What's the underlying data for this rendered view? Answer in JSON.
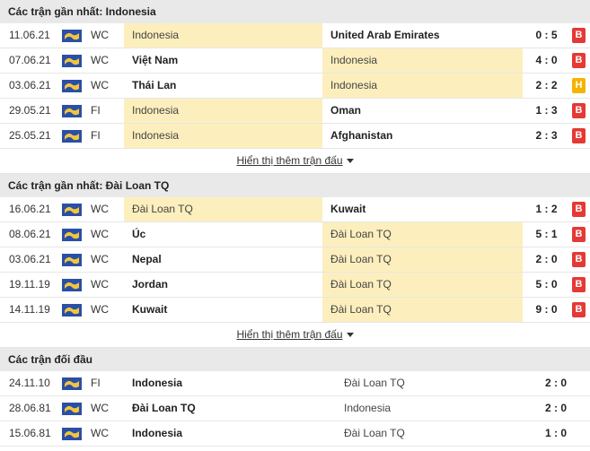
{
  "colors": {
    "header_bg": "#e9e9e9",
    "highlight": "#fcefbd",
    "loss": "#e53935",
    "draw": "#f4b400"
  },
  "sections": [
    {
      "title": "Các trận gần nhất: Indonesia",
      "more_label": "Hiển thị thêm trận đấu",
      "matches": [
        {
          "date": "11.06.21",
          "comp": "WC",
          "home": "Indonesia",
          "away": "United Arab Emirates",
          "score": "0 : 5",
          "result": "B",
          "hl": "home"
        },
        {
          "date": "07.06.21",
          "comp": "WC",
          "home": "Việt Nam",
          "away": "Indonesia",
          "score": "4 : 0",
          "result": "B",
          "hl": "away"
        },
        {
          "date": "03.06.21",
          "comp": "WC",
          "home": "Thái Lan",
          "away": "Indonesia",
          "score": "2 : 2",
          "result": "H",
          "hl": "away"
        },
        {
          "date": "29.05.21",
          "comp": "FI",
          "home": "Indonesia",
          "away": "Oman",
          "score": "1 : 3",
          "result": "B",
          "hl": "home"
        },
        {
          "date": "25.05.21",
          "comp": "FI",
          "home": "Indonesia",
          "away": "Afghanistan",
          "score": "2 : 3",
          "result": "B",
          "hl": "home"
        }
      ]
    },
    {
      "title": "Các trận gần nhất: Đài Loan TQ",
      "more_label": "Hiển thị thêm trận đấu",
      "matches": [
        {
          "date": "16.06.21",
          "comp": "WC",
          "home": "Đài Loan TQ",
          "away": "Kuwait",
          "score": "1 : 2",
          "result": "B",
          "hl": "home"
        },
        {
          "date": "08.06.21",
          "comp": "WC",
          "home": "Úc",
          "away": "Đài Loan TQ",
          "score": "5 : 1",
          "result": "B",
          "hl": "away"
        },
        {
          "date": "03.06.21",
          "comp": "WC",
          "home": "Nepal",
          "away": "Đài Loan TQ",
          "score": "2 : 0",
          "result": "B",
          "hl": "away"
        },
        {
          "date": "19.11.19",
          "comp": "WC",
          "home": "Jordan",
          "away": "Đài Loan TQ",
          "score": "5 : 0",
          "result": "B",
          "hl": "away"
        },
        {
          "date": "14.11.19",
          "comp": "WC",
          "home": "Kuwait",
          "away": "Đài Loan TQ",
          "score": "9 : 0",
          "result": "B",
          "hl": "away"
        }
      ]
    }
  ],
  "h2h": {
    "title": "Các trận đối đầu",
    "matches": [
      {
        "date": "24.11.10",
        "comp": "FI",
        "home": "Indonesia",
        "away": "Đài Loan TQ",
        "score": "2 : 0",
        "bold": "home"
      },
      {
        "date": "28.06.81",
        "comp": "WC",
        "home": "Đài Loan TQ",
        "away": "Indonesia",
        "score": "2 : 0",
        "bold": "home"
      },
      {
        "date": "15.06.81",
        "comp": "WC",
        "home": "Indonesia",
        "away": "Đài Loan TQ",
        "score": "1 : 0",
        "bold": "home"
      }
    ]
  }
}
